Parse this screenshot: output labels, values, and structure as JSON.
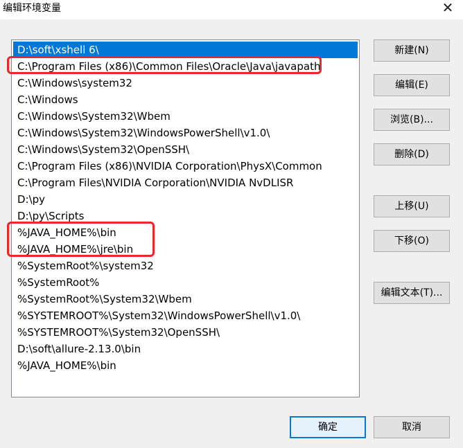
{
  "dialog": {
    "title": "编辑环境变量",
    "close_glyph": "✕"
  },
  "paths": [
    "D:\\soft\\xshell 6\\",
    "C:\\Program Files (x86)\\Common Files\\Oracle\\Java\\javapath",
    "C:\\Windows\\system32",
    "C:\\Windows",
    "C:\\Windows\\System32\\Wbem",
    "C:\\Windows\\System32\\WindowsPowerShell\\v1.0\\",
    "C:\\Windows\\System32\\OpenSSH\\",
    "C:\\Program Files (x86)\\NVIDIA Corporation\\PhysX\\Common",
    "C:\\Program Files\\NVIDIA Corporation\\NVIDIA NvDLISR",
    "D:\\py",
    "D:\\py\\Scripts",
    "%JAVA_HOME%\\bin",
    "%JAVA_HOME%\\jre\\bin",
    "%SystemRoot%\\system32",
    "%SystemRoot%",
    "%SystemRoot%\\System32\\Wbem",
    "%SYSTEMROOT%\\System32\\WindowsPowerShell\\v1.0\\",
    "%SYSTEMROOT%\\System32\\OpenSSH\\",
    "D:\\soft\\allure-2.13.0\\bin",
    "%JAVA_HOME%\\bin"
  ],
  "selected_index": 0,
  "buttons": {
    "new": "新建(N)",
    "edit": "编辑(E)",
    "browse": "浏览(B)...",
    "delete": "删除(D)",
    "move_up": "上移(U)",
    "move_down": "下移(O)",
    "edit_text": "编辑文本(T)...",
    "ok": "确定",
    "cancel": "取消"
  },
  "colors": {
    "selection": "#0078d7",
    "annotation": "#e8282a"
  }
}
